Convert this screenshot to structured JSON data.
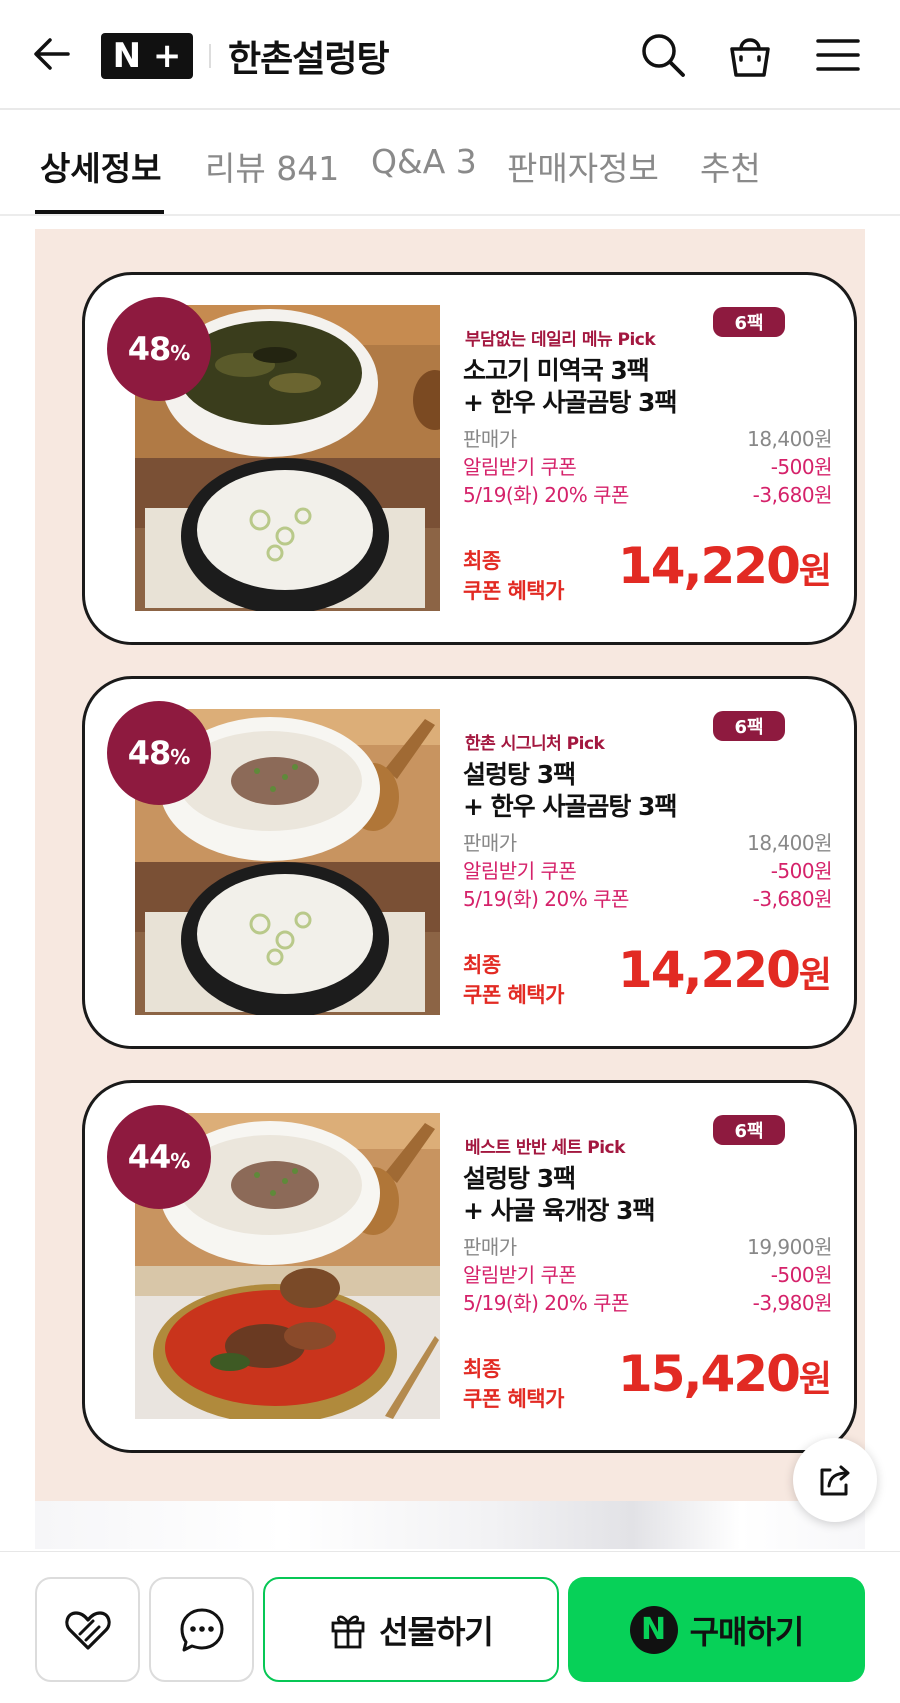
{
  "header": {
    "logo_left": "N",
    "logo_right": "+",
    "store_name": "한촌설렁탕"
  },
  "tabs": [
    {
      "label": "상세정보"
    },
    {
      "label": "리뷰 841"
    },
    {
      "label": "Q&A 3"
    },
    {
      "label": "판매자정보"
    },
    {
      "label": "추천"
    }
  ],
  "products": [
    {
      "discount": "48",
      "discount_sign": "%",
      "pick": "부담없는 데일리 메뉴 Pick",
      "pack": "6팩",
      "name_line1": "소고기 미역국 3팩",
      "name_line2": "+ 한우 사골곰탕 3팩",
      "price_label": "판매가",
      "price_value": "18,400원",
      "coupon1_label": "알림받기 쿠폰",
      "coupon1_value": "-500원",
      "coupon2_label": "5/19(화) 20% 쿠폰",
      "coupon2_value": "-3,680원",
      "final_label_1": "최종",
      "final_label_2": "쿠폰 혜택가",
      "final_price": "14,220",
      "final_unit": "원"
    },
    {
      "discount": "48",
      "discount_sign": "%",
      "pick": "한촌 시그니처 Pick",
      "pack": "6팩",
      "name_line1": "설렁탕 3팩",
      "name_line2": "+ 한우 사골곰탕 3팩",
      "price_label": "판매가",
      "price_value": "18,400원",
      "coupon1_label": "알림받기 쿠폰",
      "coupon1_value": "-500원",
      "coupon2_label": "5/19(화) 20% 쿠폰",
      "coupon2_value": "-3,680원",
      "final_label_1": "최종",
      "final_label_2": "쿠폰 혜택가",
      "final_price": "14,220",
      "final_unit": "원"
    },
    {
      "discount": "44",
      "discount_sign": "%",
      "pick": "베스트 반반 세트 Pick",
      "pack": "6팩",
      "name_line1": "설렁탕 3팩",
      "name_line2": "+ 사골 육개장 3팩",
      "price_label": "판매가",
      "price_value": "19,900원",
      "coupon1_label": "알림받기 쿠폰",
      "coupon1_value": "-500원",
      "coupon2_label": "5/19(화) 20% 쿠폰",
      "coupon2_value": "-3,980원",
      "final_label_1": "최종",
      "final_label_2": "쿠폰 혜택가",
      "final_price": "15,420",
      "final_unit": "원"
    }
  ],
  "bottom_bar": {
    "gift_label": "선물하기",
    "buy_label": "구매하기",
    "buy_badge": "N"
  },
  "icons": {
    "back": "back-arrow-icon",
    "search": "search-icon",
    "cart": "shopping-bag-icon",
    "menu": "hamburger-menu-icon",
    "share": "share-icon",
    "wish": "heart-icon",
    "talk": "chat-icon",
    "gift": "gift-icon"
  },
  "colors": {
    "brand_green": "#07d158",
    "badge_maroon": "#8e1a3f",
    "price_red": "#e22a23",
    "coupon_pink": "#d5226a",
    "content_bg": "#f7e8e0"
  }
}
